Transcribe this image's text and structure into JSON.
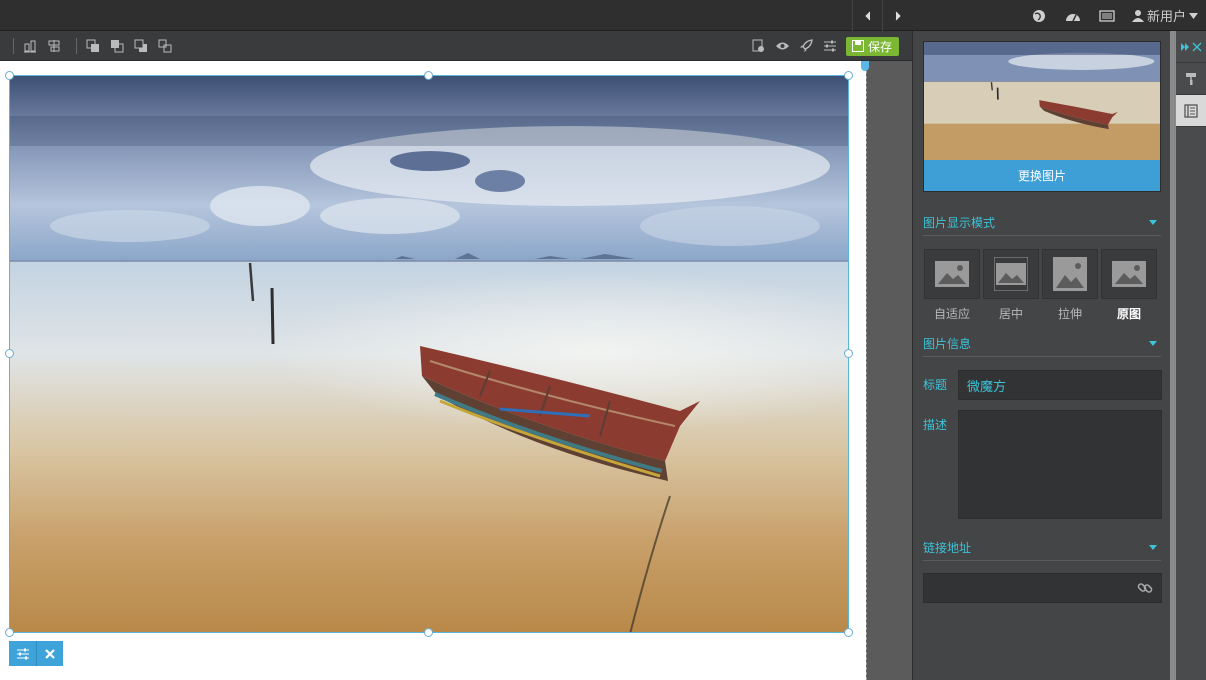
{
  "header": {
    "user_label": "新用户"
  },
  "toolbar": {
    "save_label": "保存"
  },
  "panel": {
    "replace_image_label": "更换图片",
    "display_mode_section": "图片显示模式",
    "display_modes": [
      {
        "label": "自适应",
        "active": false
      },
      {
        "label": "居中",
        "active": false
      },
      {
        "label": "拉伸",
        "active": false
      },
      {
        "label": "原图",
        "active": true
      }
    ],
    "image_info_section": "图片信息",
    "title_label": "标题",
    "title_value": "微魔方",
    "description_label": "描述",
    "description_value": "",
    "link_section": "链接地址",
    "link_value": ""
  },
  "colors": {
    "accent": "#3cc4d8",
    "save_green": "#7cb734",
    "selection_blue": "#3ea3d9"
  },
  "icons": [
    "chevron-left-icon",
    "chevron-right-icon",
    "globe-icon",
    "dashboard-icon",
    "list-icon",
    "user-icon",
    "caret-down-icon",
    "align-icon",
    "distribute-icon",
    "bring-front-icon",
    "bring-forward-icon",
    "send-backward-icon",
    "send-back-icon",
    "copy-icon",
    "eye-icon",
    "rocket-icon",
    "sliders-icon",
    "floppy-icon",
    "link-icon",
    "collapse-icon",
    "close-icon",
    "paint-roller-icon",
    "book-icon"
  ]
}
